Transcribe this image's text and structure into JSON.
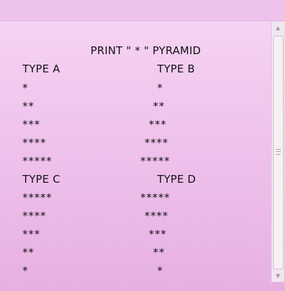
{
  "title": "PRINT \" * \" PYRAMID",
  "types": {
    "a": "TYPE A",
    "b": "TYPE B",
    "c": "TYPE C",
    "d": "TYPE D"
  },
  "pyramid_a": [
    "*",
    "**",
    "***",
    "****",
    "*****"
  ],
  "pyramid_b": [
    "*",
    "**",
    "***",
    "****",
    "*****"
  ],
  "pyramid_c": [
    "*****",
    "****",
    "***",
    "**",
    "*"
  ],
  "pyramid_d": [
    "*****",
    "****",
    "***",
    "**",
    "*"
  ],
  "scrollbar": {
    "up_icon": "chevron-up-icon",
    "down_icon": "chevron-down-icon",
    "up_glyph": "▲",
    "down_glyph": "▼"
  }
}
